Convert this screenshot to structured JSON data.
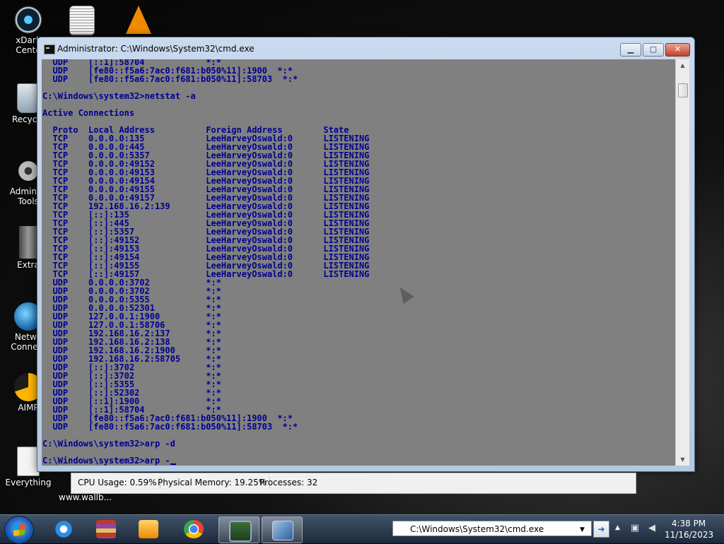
{
  "desktop": {
    "icons": [
      {
        "label": "xDark",
        "label2": "Cente"
      },
      {
        "label": "Recycle",
        "label2": ""
      },
      {
        "label": "Administ",
        "label2": "Tools"
      },
      {
        "label": "Extra",
        "label2": ""
      },
      {
        "label": "Netwo",
        "label2": "Connect"
      },
      {
        "label": "AIMP",
        "label2": ""
      },
      {
        "label": "Everything",
        "label2": ""
      }
    ],
    "url_text": "www.wallb..."
  },
  "window": {
    "title": "Administrator: C:\\Windows\\System32\\cmd.exe",
    "minimize": "▁",
    "maximize": "▢",
    "close": "✕"
  },
  "console": {
    "lines": [
      "  UDP    [::1]:58704            *:*",
      "  UDP    [fe80::f5a6:7ac0:f681:b050%11]:1900  *:*",
      "  UDP    [fe80::f5a6:7ac0:f681:b050%11]:58703  *:*",
      "",
      "C:\\Windows\\system32>netstat -a",
      "",
      "Active Connections",
      "",
      "  Proto  Local Address          Foreign Address        State",
      "  TCP    0.0.0.0:135            LeeHarveyOswald:0      LISTENING",
      "  TCP    0.0.0.0:445            LeeHarveyOswald:0      LISTENING",
      "  TCP    0.0.0.0:5357           LeeHarveyOswald:0      LISTENING",
      "  TCP    0.0.0.0:49152          LeeHarveyOswald:0      LISTENING",
      "  TCP    0.0.0.0:49153          LeeHarveyOswald:0      LISTENING",
      "  TCP    0.0.0.0:49154          LeeHarveyOswald:0      LISTENING",
      "  TCP    0.0.0.0:49155          LeeHarveyOswald:0      LISTENING",
      "  TCP    0.0.0.0:49157          LeeHarveyOswald:0      LISTENING",
      "  TCP    192.168.16.2:139       LeeHarveyOswald:0      LISTENING",
      "  TCP    [::]:135               LeeHarveyOswald:0      LISTENING",
      "  TCP    [::]:445               LeeHarveyOswald:0      LISTENING",
      "  TCP    [::]:5357              LeeHarveyOswald:0      LISTENING",
      "  TCP    [::]:49152             LeeHarveyOswald:0      LISTENING",
      "  TCP    [::]:49153             LeeHarveyOswald:0      LISTENING",
      "  TCP    [::]:49154             LeeHarveyOswald:0      LISTENING",
      "  TCP    [::]:49155             LeeHarveyOswald:0      LISTENING",
      "  TCP    [::]:49157             LeeHarveyOswald:0      LISTENING",
      "  UDP    0.0.0.0:3702           *:*",
      "  UDP    0.0.0.0:3702           *:*",
      "  UDP    0.0.0.0:5355           *:*",
      "  UDP    0.0.0.0:52301          *:*",
      "  UDP    127.0.0.1:1900         *:*",
      "  UDP    127.0.0.1:58706        *:*",
      "  UDP    192.168.16.2:137       *:*",
      "  UDP    192.168.16.2:138       *:*",
      "  UDP    192.168.16.2:1900      *:*",
      "  UDP    192.168.16.2:58705     *:*",
      "  UDP    [::]:3702              *:*",
      "  UDP    [::]:3702              *:*",
      "  UDP    [::]:5355              *:*",
      "  UDP    [::]:52302             *:*",
      "  UDP    [::1]:1900             *:*",
      "  UDP    [::1]:58704            *:*",
      "  UDP    [fe80::f5a6:7ac0:f681:b050%11]:1900  *:*",
      "  UDP    [fe80::f5a6:7ac0:f681:b050%11]:58703  *:*",
      "",
      "C:\\Windows\\system32>arp -d",
      "",
      "C:\\Windows\\system32>arp -"
    ]
  },
  "statusbar": {
    "cpu": "CPU Usage: 0.59%",
    "memory": "Physical Memory: 19.25%",
    "processes": "Processes: 32"
  },
  "taskbar": {
    "address": "C:\\Windows\\System32\\cmd.exe",
    "go": "➜",
    "time": "4:38 PM",
    "date": "11/16/2023"
  },
  "colors": {
    "console_bg": "#808080",
    "console_fg": "#000090"
  }
}
